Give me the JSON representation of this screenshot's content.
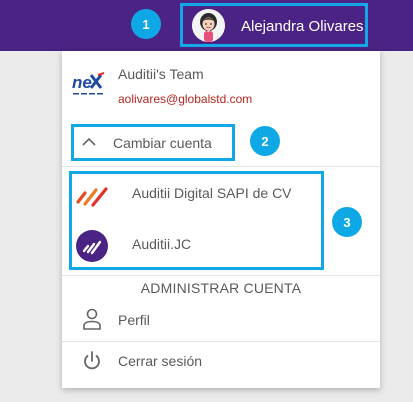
{
  "header": {
    "user_name": "Alejandra Olivares",
    "avatar_icon": "user-avatar-illustration",
    "background_color": "#4a2384"
  },
  "annotations": {
    "badge_1": "1",
    "badge_2": "2",
    "badge_3": "3",
    "highlight_color": "#12a8e8"
  },
  "team": {
    "name": "Auditii's Team",
    "email": "aolivares@globalstd.com",
    "logo_icon": "nex-logo"
  },
  "switch_account": {
    "label": "Cambiar cuenta",
    "icon": "chevron-up-icon"
  },
  "accounts": [
    {
      "name": "Auditii Digital SAPI de CV",
      "icon": "auditii-logo-orange"
    },
    {
      "name": "Auditii.JC",
      "icon": "auditii-logo-purple"
    }
  ],
  "admin": {
    "heading": "ADMINISTRAR CUENTA",
    "items": [
      {
        "label": "Perfil",
        "icon": "person-icon"
      },
      {
        "label": "Cerrar sesión",
        "icon": "power-icon"
      }
    ]
  }
}
